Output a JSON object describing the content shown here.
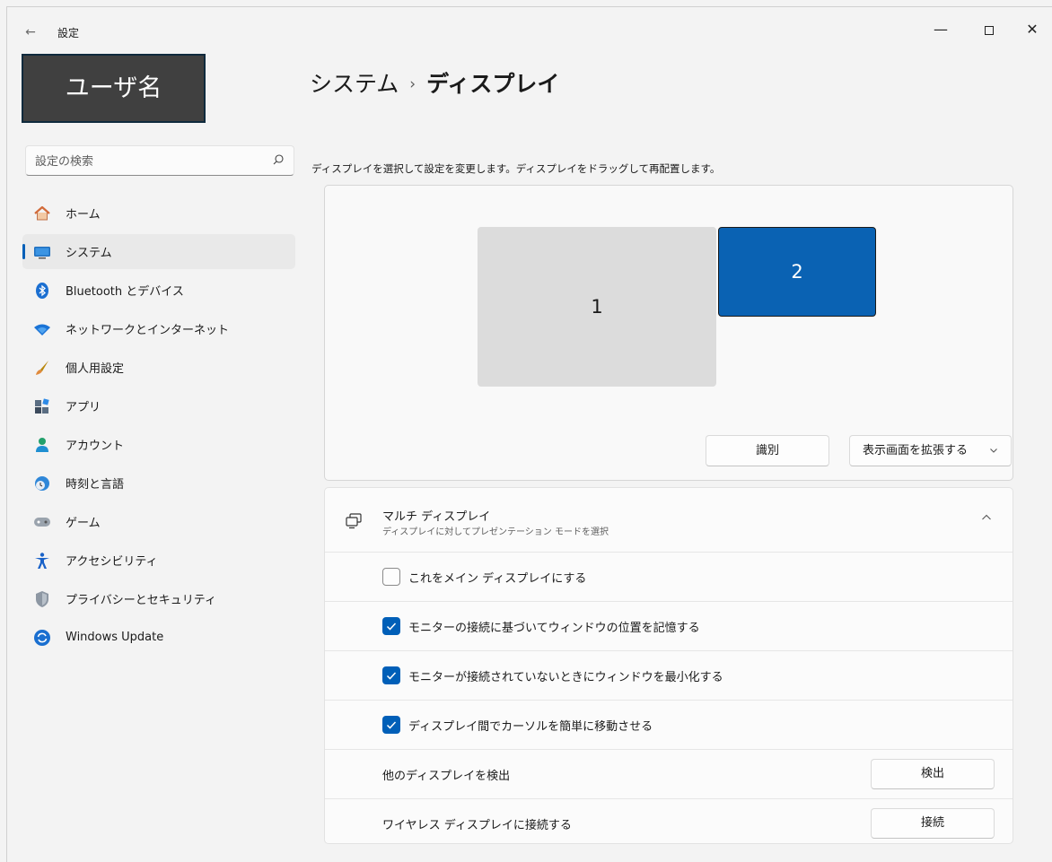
{
  "window": {
    "title": "設定",
    "controls": {
      "minimize": "—",
      "close": "✕"
    }
  },
  "user": {
    "name": "ユーザ名"
  },
  "search": {
    "placeholder": "設定の検索"
  },
  "nav": {
    "items": [
      {
        "label": "ホーム",
        "icon": "home-icon"
      },
      {
        "label": "システム",
        "icon": "system-icon",
        "active": true
      },
      {
        "label": "Bluetooth とデバイス",
        "icon": "bluetooth-icon"
      },
      {
        "label": "ネットワークとインターネット",
        "icon": "wifi-icon"
      },
      {
        "label": "個人用設定",
        "icon": "brush-icon"
      },
      {
        "label": "アプリ",
        "icon": "apps-icon"
      },
      {
        "label": "アカウント",
        "icon": "account-icon"
      },
      {
        "label": "時刻と言語",
        "icon": "time-language-icon"
      },
      {
        "label": "ゲーム",
        "icon": "gamepad-icon"
      },
      {
        "label": "アクセシビリティ",
        "icon": "accessibility-icon"
      },
      {
        "label": "プライバシーとセキュリティ",
        "icon": "shield-icon"
      },
      {
        "label": "Windows Update",
        "icon": "update-icon"
      }
    ]
  },
  "breadcrumb": {
    "parent": "システム",
    "separator": "›",
    "current": "ディスプレイ"
  },
  "display": {
    "description": "ディスプレイを選択して設定を変更します。ディスプレイをドラッグして再配置します。",
    "monitors": [
      "1",
      "2"
    ],
    "identify_label": "識別",
    "mode_label": "表示画面を拡張する",
    "selected_color": "#0a62b3"
  },
  "multi_display": {
    "title": "マルチ ディスプレイ",
    "subtitle": "ディスプレイに対してプレゼンテーション モードを選択",
    "options": [
      {
        "label": "これをメイン ディスプレイにする",
        "checked": false
      },
      {
        "label": "モニターの接続に基づいてウィンドウの位置を記憶する",
        "checked": true
      },
      {
        "label": "モニターが接続されていないときにウィンドウを最小化する",
        "checked": true
      },
      {
        "label": "ディスプレイ間でカーソルを簡単に移動させる",
        "checked": true
      }
    ],
    "detect": {
      "label": "他のディスプレイを検出",
      "button": "検出"
    },
    "wireless": {
      "label": "ワイヤレス ディスプレイに接続する",
      "button": "接続"
    }
  },
  "accent_color": "#005fb8"
}
